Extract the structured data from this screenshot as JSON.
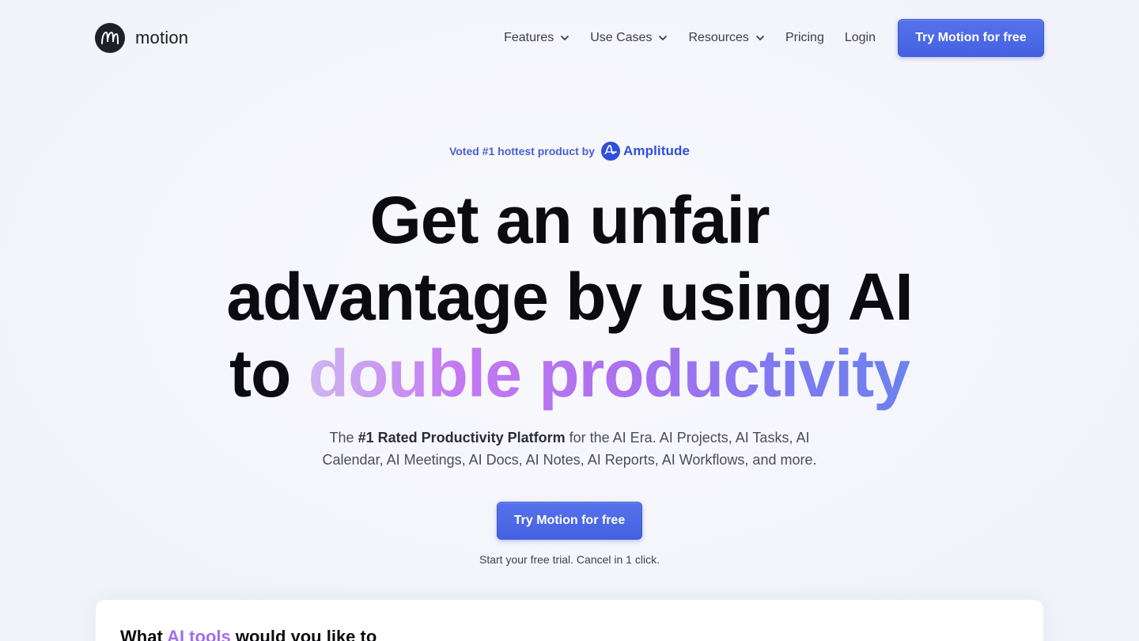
{
  "brand": {
    "name": "motion",
    "logo_icon": "motion-logo-icon"
  },
  "nav": {
    "items": [
      {
        "label": "Features",
        "has_dropdown": true
      },
      {
        "label": "Use Cases",
        "has_dropdown": true
      },
      {
        "label": "Resources",
        "has_dropdown": true
      },
      {
        "label": "Pricing",
        "has_dropdown": false
      }
    ],
    "login": "Login",
    "cta": "Try Motion for free"
  },
  "hero": {
    "voted_text": "Voted #1 hottest product by",
    "voted_brand": "Amplitude",
    "headline_line1": "Get an unfair",
    "headline_line2": "advantage by using AI",
    "headline_line3_prefix": "to ",
    "headline_line3_highlight": "double productivity",
    "sub_prefix": "The ",
    "sub_bold": "#1 Rated Productivity Platform",
    "sub_rest": " for the AI Era. AI Projects, AI Tasks, AI",
    "sub_line2": "Calendar, AI Meetings, AI Docs, AI Notes, AI Reports, AI Workflows, and more.",
    "cta": "Try Motion for free",
    "trial_note": "Start your free trial. Cancel in 1 click."
  },
  "card": {
    "title_prefix": "What ",
    "title_highlight": "AI tools",
    "title_suffix": " would you like to"
  },
  "colors": {
    "accent": "#4461e2",
    "headline": "#0b0b10",
    "amplitude": "#2f4fd8",
    "gradient_start": "#cfb6f0",
    "gradient_end": "#6b82ee"
  }
}
